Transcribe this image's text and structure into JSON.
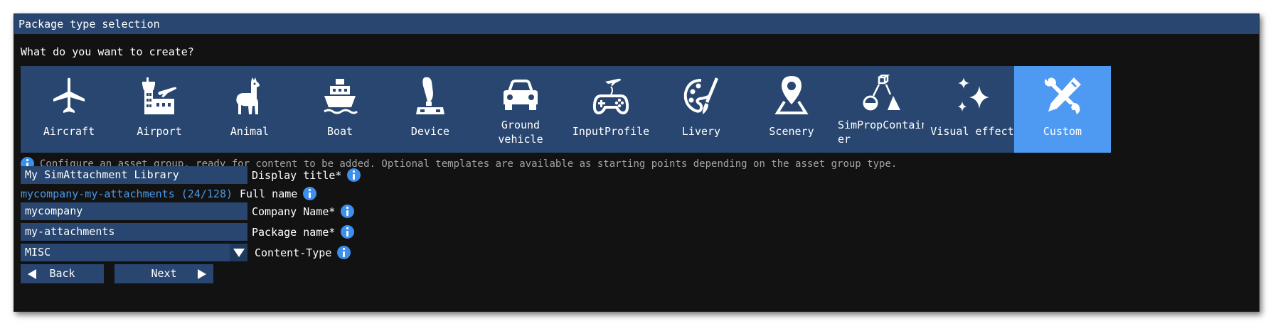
{
  "window": {
    "title": "Package type selection",
    "question": "What do you want to create?"
  },
  "tiles": [
    {
      "label": "Aircraft",
      "icon": "airplane-icon"
    },
    {
      "label": "Airport",
      "icon": "airport-tower-icon"
    },
    {
      "label": "Animal",
      "icon": "llama-icon"
    },
    {
      "label": "Boat",
      "icon": "ship-icon"
    },
    {
      "label": "Device",
      "icon": "joystick-icon"
    },
    {
      "label": "Ground vehicle",
      "icon": "car-icon"
    },
    {
      "label": "InputProfile",
      "icon": "gamepad-icon"
    },
    {
      "label": "Livery",
      "icon": "palette-icon"
    },
    {
      "label": "Scenery",
      "icon": "map-pin-icon"
    },
    {
      "label": "SimPropContainer",
      "icon": "shapes-icon"
    },
    {
      "label": "Visual effect",
      "icon": "sparkles-icon"
    },
    {
      "label": "Custom",
      "icon": "tools-icon",
      "selected": true
    }
  ],
  "description": "Configure an asset group, ready for content to be added. Optional templates are available as starting points depending on the asset group type.",
  "form": {
    "display_title": {
      "value": "My SimAttachment Library",
      "label": "Display title*"
    },
    "full_name": {
      "value": "mycompany-my-attachments (24/128)",
      "label": "Full name"
    },
    "company_name": {
      "value": "mycompany",
      "label": "Company Name*"
    },
    "package_name": {
      "value": "my-attachments",
      "label": "Package name*"
    },
    "content_type": {
      "value": "MISC",
      "label": "Content-Type"
    }
  },
  "buttons": {
    "back": "Back",
    "next": "Next"
  },
  "colors": {
    "background": "#121212",
    "titlebar": "#28466f",
    "tile": "#28466f",
    "tile_selected": "#4e9af2",
    "info": "#3d8fee",
    "fullname_text": "#4b9ae8",
    "description_text": "#a4a4a4"
  }
}
